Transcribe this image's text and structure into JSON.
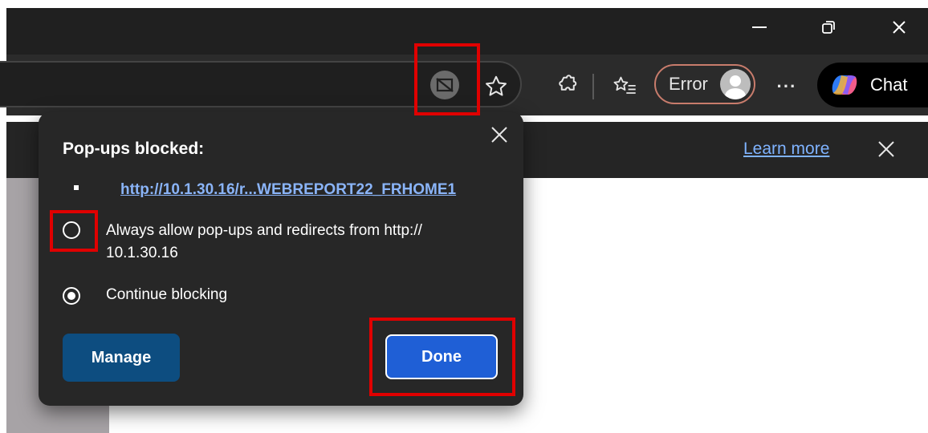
{
  "window": {
    "minimize_glyph": "—",
    "restore_glyph": "❐",
    "close_glyph": "✕"
  },
  "toolbar": {
    "error_label": "Error",
    "more_glyph": "···",
    "chat_label": "Chat",
    "icons": [
      "popup-blocked-icon",
      "favorite-star-icon",
      "extensions-icon",
      "favorites-list-icon",
      "profile-avatar-icon",
      "copilot-icon"
    ]
  },
  "infobar": {
    "learn_more": "Learn more",
    "close_glyph": "✕"
  },
  "popup": {
    "title": "Pop-ups blocked:",
    "close_glyph": "✕",
    "blocked_url": "http://10.1.30.16/r...WEBREPORT22_FRHOME1",
    "option_allow_line1": "Always allow pop-ups and redirects from http://",
    "option_allow_line2": "10.1.30.16",
    "option_allow_selected": false,
    "option_block": "Continue blocking",
    "option_block_selected": true,
    "manage_label": "Manage",
    "done_label": "Done"
  },
  "colors": {
    "highlight": "#e00000",
    "done_button": "#1f5fd6",
    "manage_button": "#0d4d80",
    "link": "#8ab4f8",
    "error_outline": "#c87c6c"
  }
}
